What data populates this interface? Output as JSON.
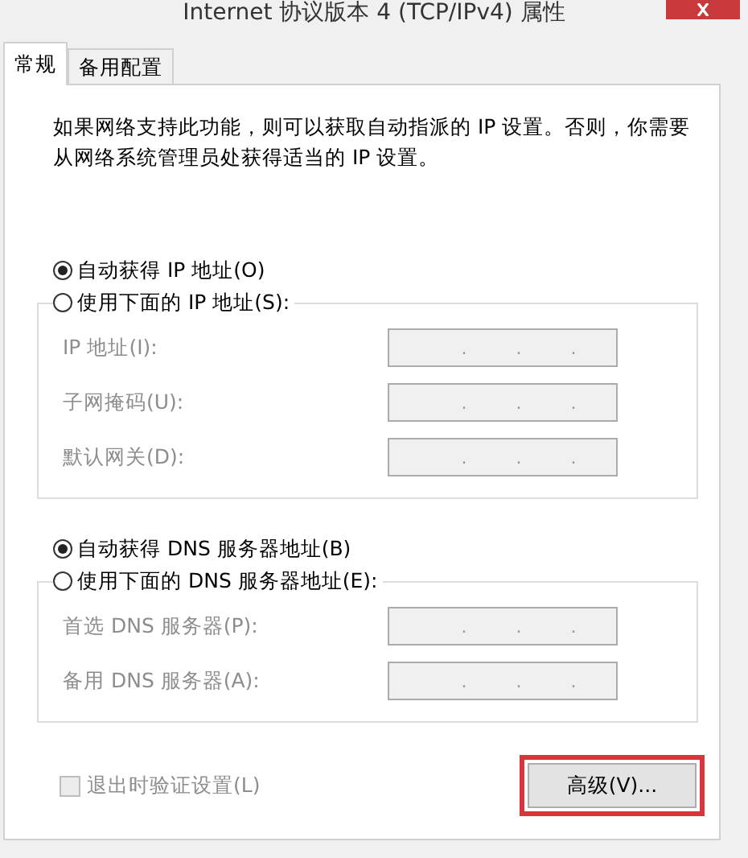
{
  "window": {
    "title": "Internet 协议版本 4 (TCP/IPv4) 属性"
  },
  "tabs": [
    {
      "label": "常规",
      "selected": true
    },
    {
      "label": "备用配置",
      "selected": false
    }
  ],
  "description": "如果网络支持此功能，则可以获取自动指派的 IP 设置。否则，你需要从网络系统管理员处获得适当的 IP 设置。",
  "ip_section": {
    "auto_option": {
      "label": "自动获得 IP 地址(O)",
      "selected": true
    },
    "manual_option": {
      "label": "使用下面的 IP 地址(S):",
      "selected": false
    },
    "fields": [
      {
        "label": "IP 地址(I):",
        "value": ". . .",
        "disabled": true
      },
      {
        "label": "子网掩码(U):",
        "value": ". . .",
        "disabled": true
      },
      {
        "label": "默认网关(D):",
        "value": ". . .",
        "disabled": true
      }
    ]
  },
  "dns_section": {
    "auto_option": {
      "label": "自动获得 DNS 服务器地址(B)",
      "selected": true
    },
    "manual_option": {
      "label": "使用下面的 DNS 服务器地址(E):",
      "selected": false
    },
    "fields": [
      {
        "label": "首选 DNS 服务器(P):",
        "value": ". . .",
        "disabled": true
      },
      {
        "label": "备用 DNS 服务器(A):",
        "value": ". . .",
        "disabled": true
      }
    ]
  },
  "validate_checkbox": {
    "label": "退出时验证设置(L)",
    "checked": false,
    "disabled": true
  },
  "advanced_button": {
    "label": "高级(V)...",
    "highlighted": true
  }
}
